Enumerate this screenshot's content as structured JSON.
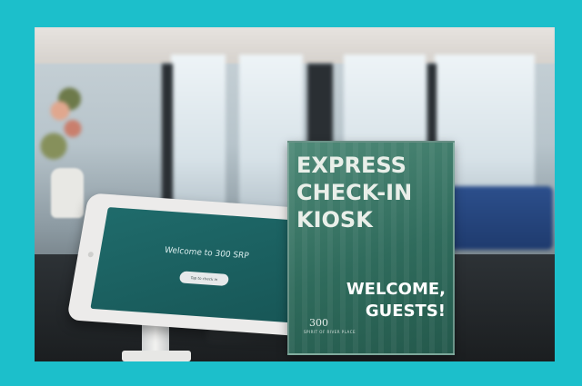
{
  "kiosk": {
    "screen_text": "Welcome to 300 SRP",
    "button_label": "Tap to check in"
  },
  "sign": {
    "title_line1": "EXPRESS",
    "title_line2": "CHECK-IN",
    "title_line3": "KIOSK",
    "welcome_line1": "WELCOME,",
    "welcome_line2": "GUESTS!",
    "logo_number": "300",
    "logo_text": "SPIRIT OF RIVER PLACE"
  },
  "colors": {
    "frame": "#1cbfcb",
    "sign_green": "#2f6b5c",
    "kiosk_screen": "#1f6b6b"
  }
}
